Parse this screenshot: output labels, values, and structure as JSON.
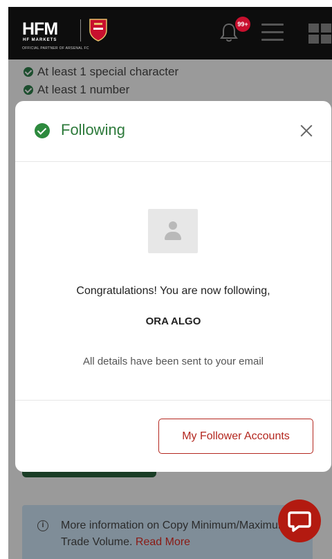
{
  "header": {
    "logo_text": "HFM",
    "logo_sub": "HF MARKETS",
    "logo_partner": "OFFICIAL PARTNER OF ARSENAL FC",
    "notification_badge": "99+",
    "colors": {
      "bar": "#0d0d0d",
      "badge": "#c8102e"
    }
  },
  "background": {
    "rules": [
      "At least 1 special character",
      "At least 1 number"
    ],
    "info_text": "More information on Copy Minimum/Maximum Trade Volume.",
    "info_link": "Read More"
  },
  "modal": {
    "title": "Following",
    "congrats_text": "Congratulations! You are now following,",
    "trader_name": "ORA ALGO",
    "details_text": "All details have been sent to your email",
    "primary_button": "My Follower Accounts",
    "colors": {
      "title": "#2d7a3b",
      "button": "#b3261e"
    }
  }
}
